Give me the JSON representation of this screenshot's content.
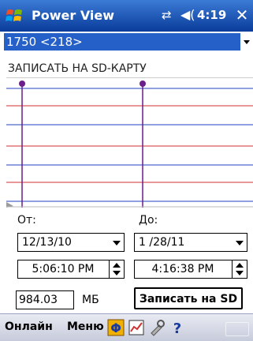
{
  "titlebar": {
    "app_title": "Power View",
    "time": "4:19",
    "close": "✕"
  },
  "device_select": {
    "value": "1750 <218>"
  },
  "sd_label": "ЗАПИСАТЬ НА SD-КАРТУ",
  "form": {
    "from_label": "От:",
    "to_label": "До:",
    "from_date": "12/13/10",
    "to_date": "1 /28/11",
    "from_time": "5:06:10 PM",
    "to_time": "4:16:38 PM",
    "size_value": "984.03",
    "size_unit": "МБ",
    "write_button": "Записать на SD"
  },
  "menubar": {
    "left": "Онлайн",
    "right": "Меню"
  },
  "colors": {
    "title_bar": "#0a3c9a",
    "selection": "#2560c8",
    "marker": "#6a1f8a",
    "red_line": "#d03030",
    "blue_line": "#2040c0"
  }
}
